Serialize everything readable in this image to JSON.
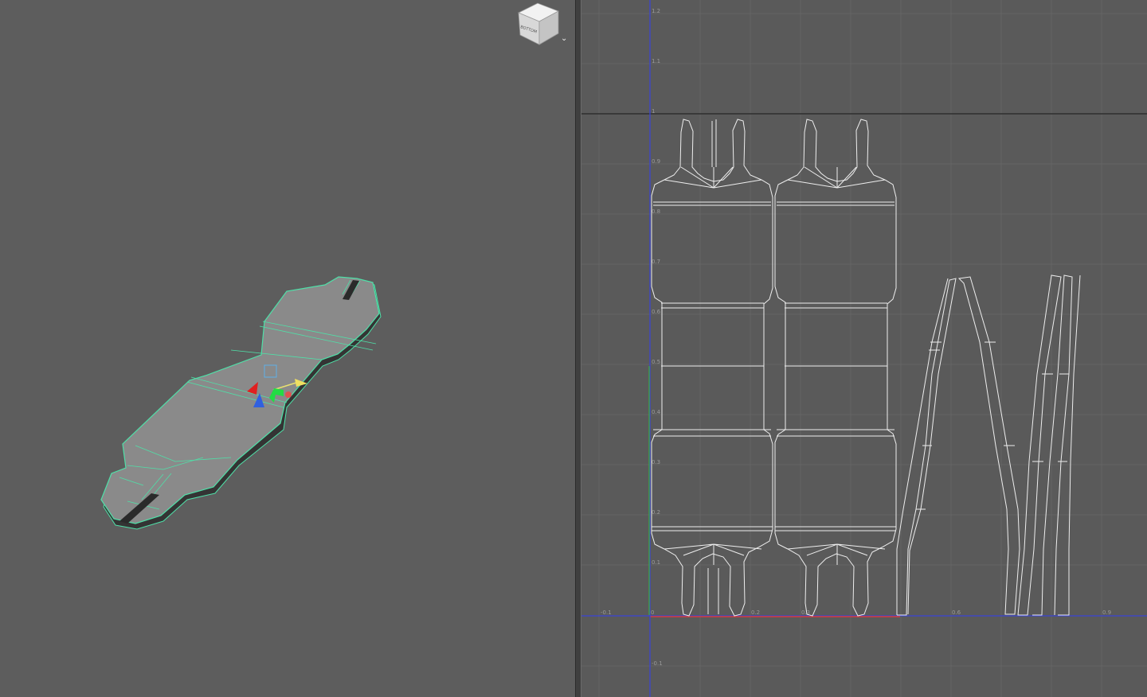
{
  "viewport": {
    "view_cube_label": "BOTTOM",
    "view_menu_icon": "chevron-down-icon"
  },
  "uv_editor": {
    "x_ticks": [
      "-0.1",
      "0",
      "0.2",
      "0.3",
      "0.6",
      "0.9"
    ],
    "y_ticks": [
      "1.2",
      "1.1",
      "1",
      "0.9",
      "0.8",
      "0.7",
      "0.6",
      "0.5",
      "0.4",
      "0.3",
      "0.2",
      "0.1",
      "-0.1"
    ],
    "colors": {
      "u_axis": "#d83a3a",
      "v_axis": "#3a44d8",
      "v_axis_positive": "#3cae3c",
      "grid": "#646464",
      "wire": "#eeeeee",
      "mesh_highlight": "#4fe0a8"
    }
  }
}
